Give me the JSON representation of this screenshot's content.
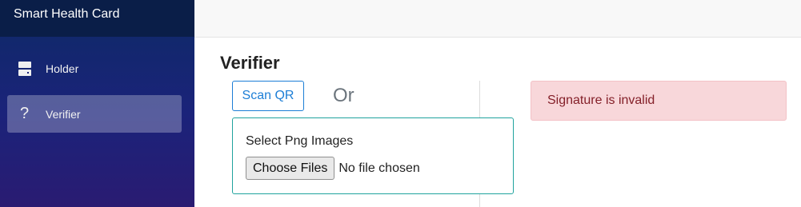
{
  "app": {
    "title": "Smart Health Card"
  },
  "sidebar": {
    "items": [
      {
        "label": "Holder",
        "icon": "server-icon",
        "active": false
      },
      {
        "label": "Verifier",
        "icon": "question-icon",
        "active": true
      }
    ]
  },
  "main": {
    "title": "Verifier",
    "scan_button": "Scan QR",
    "or_text": "Or",
    "upload": {
      "label": "Select Png Images",
      "choose_button": "Choose Files",
      "status": "No file chosen"
    },
    "alert": {
      "text": "Signature is invalid",
      "color": "#f8d7da"
    }
  },
  "colors": {
    "accent": "#1c7ed6",
    "upload_border": "#20a39e",
    "sidebar_top": "#0a1e48"
  }
}
